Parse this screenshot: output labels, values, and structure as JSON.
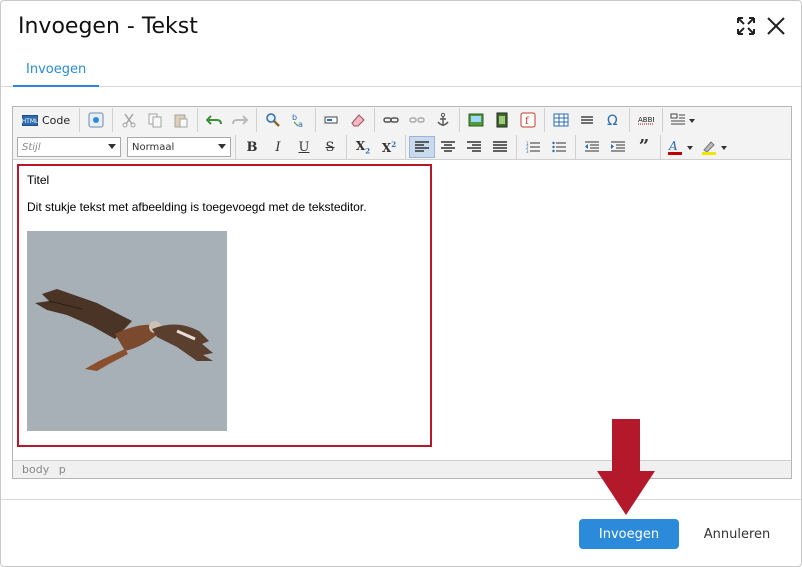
{
  "dialog": {
    "title": "Invoegen - Tekst",
    "header_icons": [
      "expand-icon",
      "close-icon"
    ]
  },
  "tabs": [
    {
      "label": "Invoegen",
      "active": true
    }
  ],
  "toolbar": {
    "code_label": "Code",
    "style_select": {
      "placeholder": "Stijl"
    },
    "format_select": {
      "value": "Normaal"
    },
    "row1_icons": [
      "html-code-icon",
      "preview-icon",
      "cut-icon",
      "copy-icon",
      "paste-icon",
      "undo-icon",
      "redo-icon",
      "find-icon",
      "replace-icon",
      "form-field-icon",
      "eraser-icon",
      "link-icon",
      "unlink-icon",
      "anchor-icon",
      "image-icon",
      "video-icon",
      "flash-icon",
      "table-icon",
      "horizontal-rule-icon",
      "omega-icon",
      "spellcheck-icon",
      "template-icon"
    ],
    "row2_icons": [
      "bold-icon",
      "italic-icon",
      "underline-icon",
      "strikethrough-icon",
      "subscript-icon",
      "superscript-icon",
      "align-left-icon",
      "align-center-icon",
      "align-right-icon",
      "align-justify-icon",
      "numbered-list-icon",
      "bulleted-list-icon",
      "outdent-icon",
      "indent-icon",
      "blockquote-icon",
      "text-color-icon",
      "highlight-icon"
    ],
    "text_color": "#c00000",
    "highlight_color": "#f2e600"
  },
  "content": {
    "heading": "Titel",
    "paragraph": "Dit stukje tekst met afbeelding is toegevoegd met de teksteditor.",
    "image_alt": "bird-image"
  },
  "statusbar": {
    "path": "body  p"
  },
  "footer": {
    "primary_label": "Invoegen",
    "cancel_label": "Annuleren"
  },
  "colors": {
    "accent": "#2b8ad9",
    "highlight_border": "#b3192b",
    "arrow": "#b3192b"
  }
}
